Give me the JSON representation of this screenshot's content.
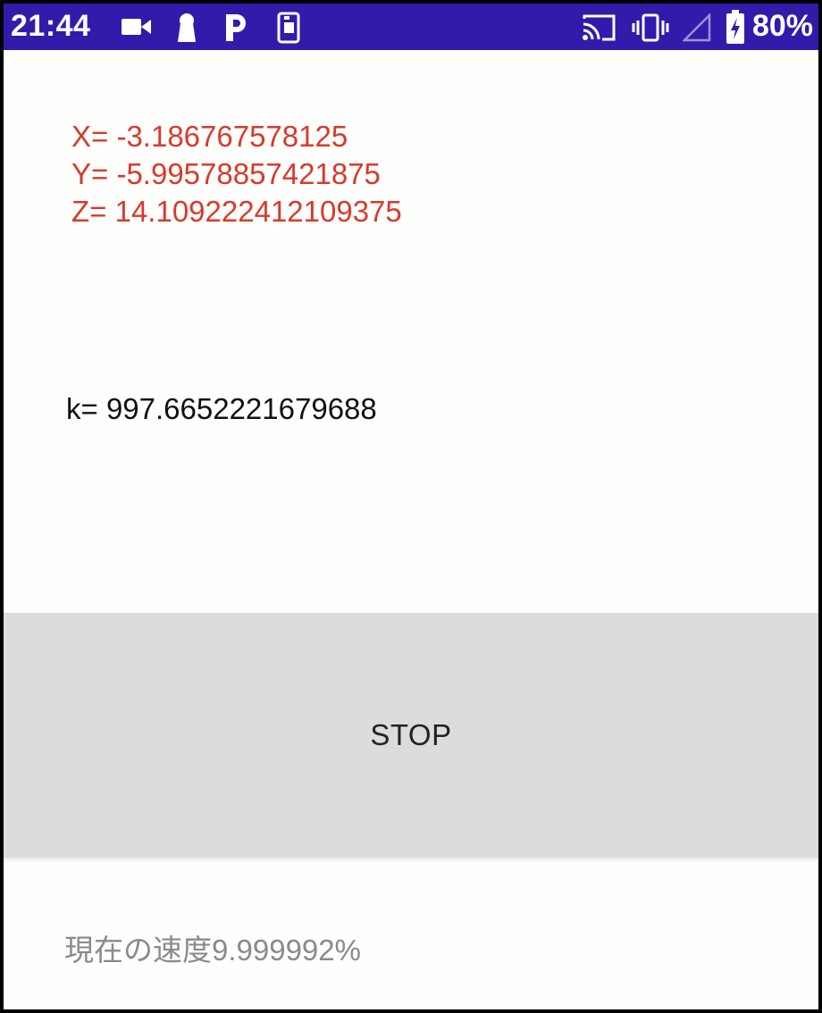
{
  "status_bar": {
    "time": "21:44",
    "battery_percent": "80%",
    "left_icons": [
      "video-camera-icon",
      "keyhole-icon",
      "parking-p-icon",
      "sim-card-icon"
    ],
    "right_icons": [
      "cast-icon",
      "vibrate-icon",
      "signal-icon",
      "battery-charging-icon"
    ],
    "background_color": "#311bab"
  },
  "accelerometer": {
    "x_line": "X= -3.186767578125",
    "y_line": "Y= -5.99578857421875",
    "z_line": "Z= 14.109222412109375",
    "color": "#d83a2c"
  },
  "k_line": "k= 997.6652221679688",
  "stop_button": {
    "label": "STOP",
    "background_color": "#dcdddb"
  },
  "speed_line": "現在の速度9.999992%"
}
